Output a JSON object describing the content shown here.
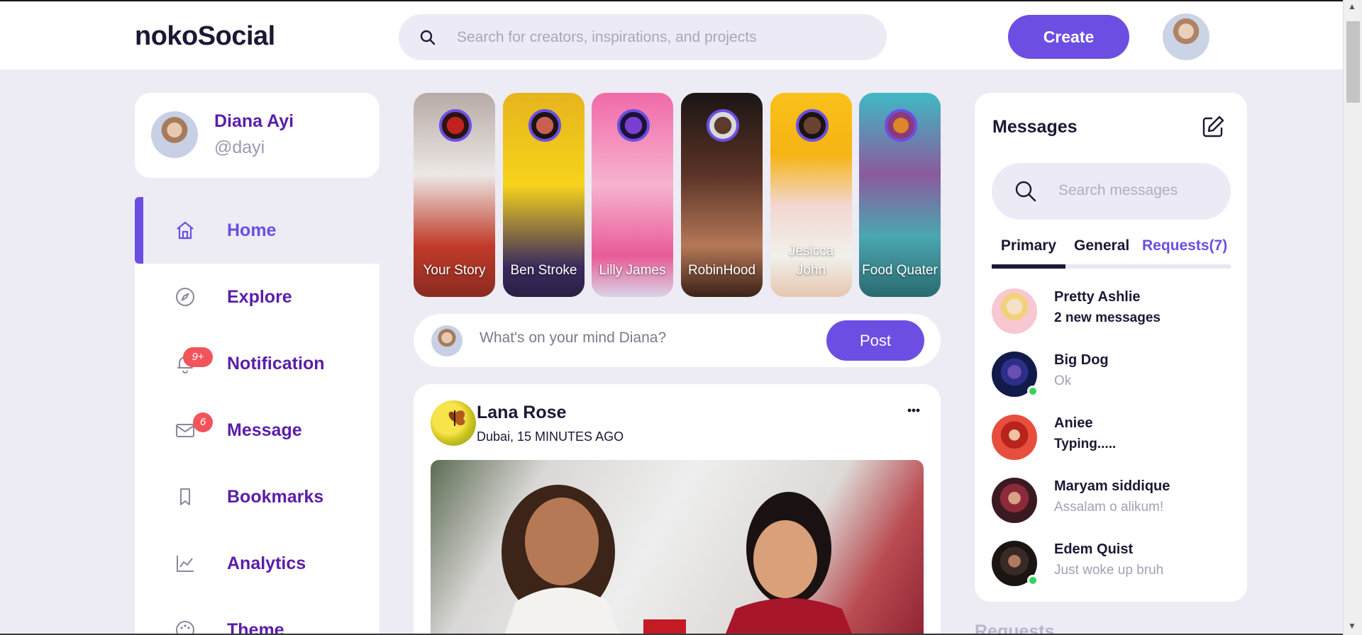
{
  "app": {
    "logo": "nokoSocial"
  },
  "search": {
    "placeholder": "Search for creators, inspirations, and projects"
  },
  "header": {
    "create_label": "Create"
  },
  "profile": {
    "name": "Diana Ayi",
    "handle": "@dayi"
  },
  "sidebar": {
    "items": [
      {
        "label": "Home",
        "icon": "home-icon",
        "active": true
      },
      {
        "label": "Explore",
        "icon": "compass-icon"
      },
      {
        "label": "Notification",
        "icon": "bell-icon",
        "badge": "9+"
      },
      {
        "label": "Message",
        "icon": "mail-icon",
        "badge": "6"
      },
      {
        "label": "Bookmarks",
        "icon": "bookmark-icon"
      },
      {
        "label": "Analytics",
        "icon": "chart-icon"
      },
      {
        "label": "Theme",
        "icon": "palette-icon"
      }
    ]
  },
  "stories": [
    {
      "label": "Your Story",
      "colors": [
        "#b8a9a5",
        "#e7e3e0",
        "#c13b2a"
      ]
    },
    {
      "label": "Ben Stroke",
      "colors": [
        "#e6b41d",
        "#f5d11c",
        "#3a2b5c"
      ]
    },
    {
      "label": "Lilly James",
      "colors": [
        "#f06aa8",
        "#f7b3d0",
        "#e85b97"
      ]
    },
    {
      "label": "RobinHood",
      "colors": [
        "#1b1514",
        "#5a3326",
        "#b57857"
      ]
    },
    {
      "label": "Jesicca John",
      "colors": [
        "#f9c11a",
        "#f6b413",
        "#f1f1ea"
      ]
    },
    {
      "label": "Food Quater",
      "colors": [
        "#3fb9c4",
        "#4aa7b0",
        "#8b5a9d"
      ]
    }
  ],
  "composer": {
    "placeholder": "What's on your mind Diana?",
    "post_label": "Post"
  },
  "feed": {
    "posts": [
      {
        "author": "Lana Rose",
        "meta": "Dubai, 15 MINUTES AGO"
      }
    ]
  },
  "messages": {
    "title": "Messages",
    "search_placeholder": "Search messages",
    "tabs": {
      "primary": "Primary",
      "general": "General",
      "requests": "Requests(7)"
    },
    "items": [
      {
        "name": "Pretty Ashlie",
        "text": "2 new messages",
        "bold": true,
        "online": false,
        "color": "#f7c7d2"
      },
      {
        "name": "Big Dog",
        "text": "Ok",
        "bold": false,
        "online": true,
        "color": "#1f2b6e"
      },
      {
        "name": "Aniee",
        "text": "Typing.....",
        "bold": true,
        "online": false,
        "color": "#e84e3d"
      },
      {
        "name": "Maryam siddique",
        "text": "Assalam o alikum!",
        "bold": false,
        "online": false,
        "color": "#6b1f2b"
      },
      {
        "name": "Edem Quist",
        "text": "Just woke up bruh",
        "bold": false,
        "online": true,
        "color": "#3a2a26"
      }
    ]
  },
  "requests": {
    "heading": "Requests"
  },
  "colors": {
    "accent": "#6c4ee3",
    "nav_text": "#5a1ea8",
    "badge": "#f2545b",
    "online": "#2fd65a",
    "background": "#edebf4"
  }
}
